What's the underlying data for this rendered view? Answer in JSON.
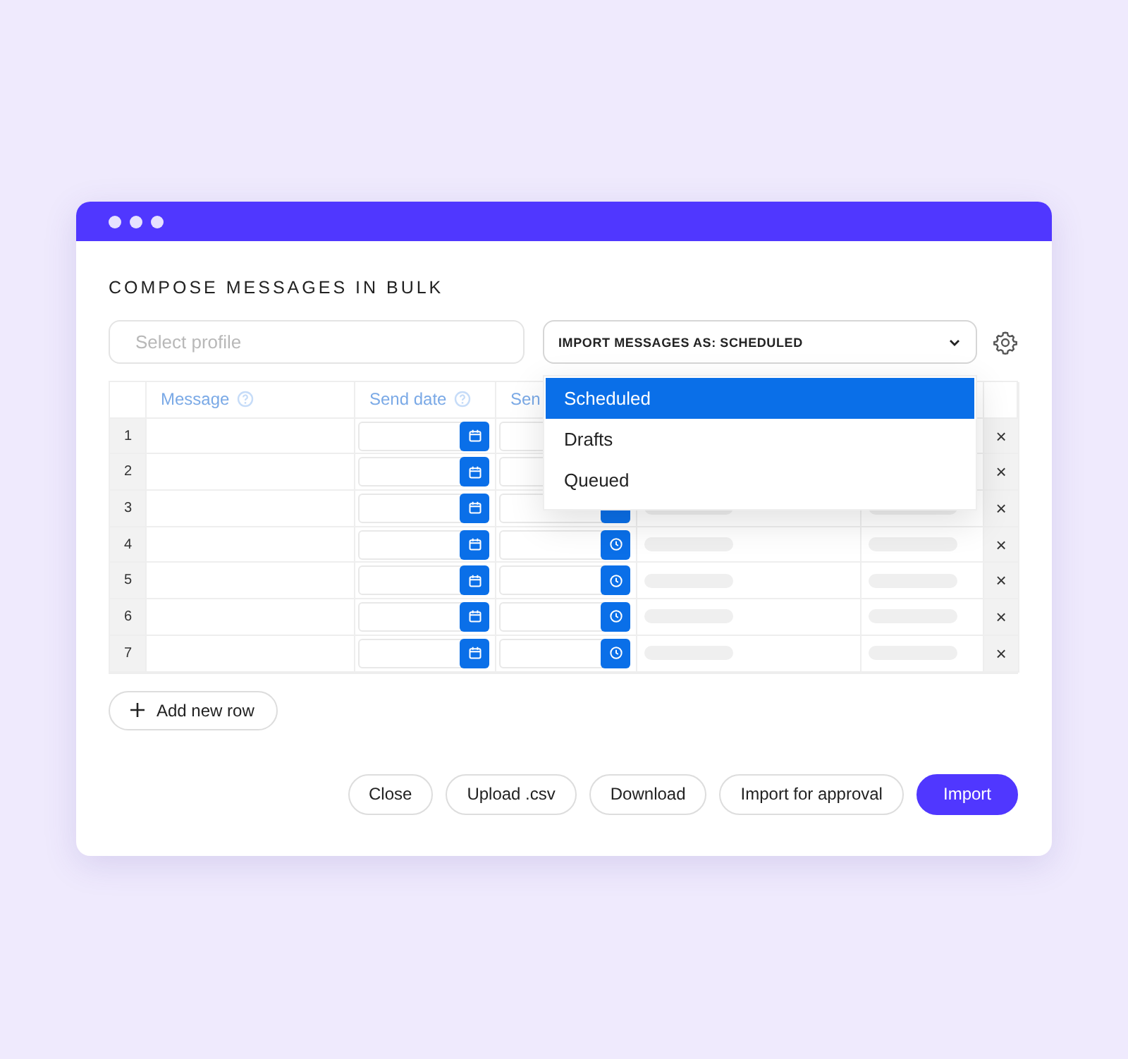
{
  "title": "COMPOSE MESSAGES IN BULK",
  "profile_field": {
    "placeholder": "Select profile"
  },
  "import_dropdown": {
    "value": "IMPORT MESSAGES AS: SCHEDULED",
    "expanded": true,
    "options": [
      {
        "label": "Scheduled",
        "selected": true
      },
      {
        "label": "Drafts",
        "selected": false
      },
      {
        "label": "Queued",
        "selected": false
      }
    ]
  },
  "table": {
    "columns": [
      {
        "label": "Message",
        "help": true
      },
      {
        "label": "Send date",
        "help": true
      },
      {
        "label": "Sen"
      }
    ],
    "rows": [
      {
        "number": "1",
        "delete": "×"
      },
      {
        "number": "2",
        "delete": "×"
      },
      {
        "number": "3",
        "delete": "×"
      },
      {
        "number": "4",
        "delete": "×"
      },
      {
        "number": "5",
        "delete": "×"
      },
      {
        "number": "6",
        "delete": "×"
      },
      {
        "number": "7",
        "delete": "×"
      }
    ]
  },
  "add_row_button": "Add new row",
  "buttons": [
    {
      "label": "Close",
      "kind": "secondary"
    },
    {
      "label": "Upload .csv",
      "kind": "secondary"
    },
    {
      "label": "Download",
      "kind": "secondary"
    },
    {
      "label": "Import for approval",
      "kind": "secondary"
    },
    {
      "label": "Import",
      "kind": "primary"
    }
  ]
}
